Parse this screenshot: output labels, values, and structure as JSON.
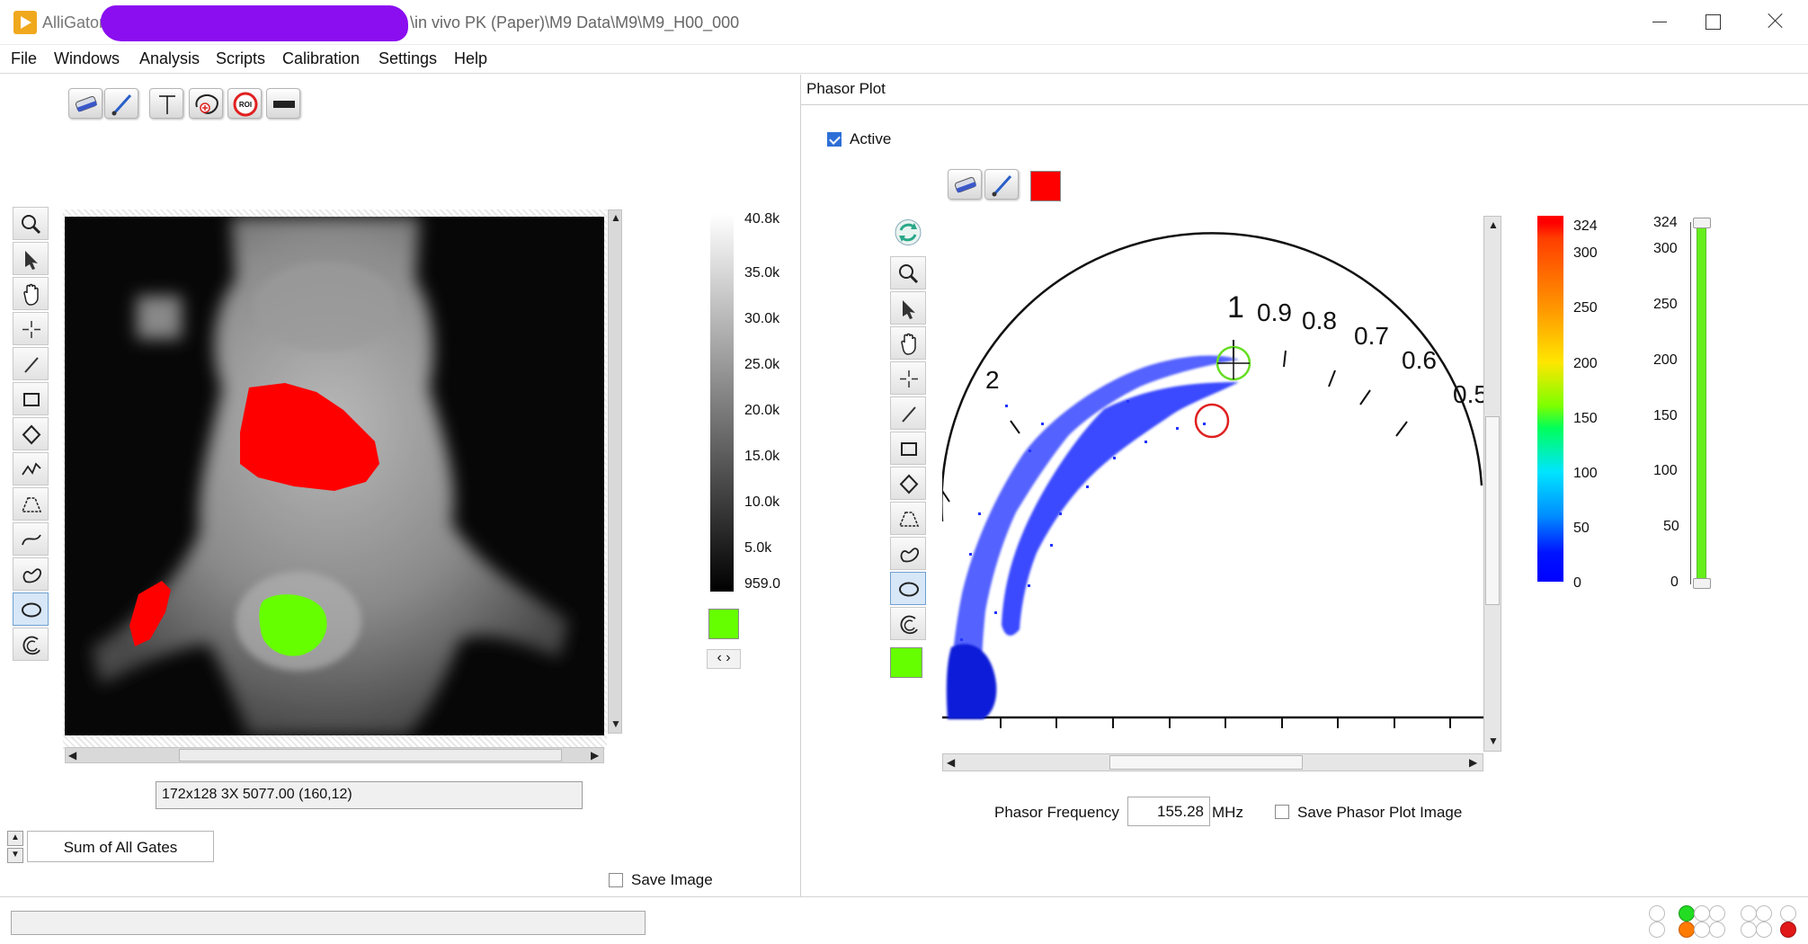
{
  "window": {
    "app_name": "AlliGator",
    "path": "\\in vivo PK (Paper)\\M9 Data\\M9\\M9_H00_000"
  },
  "menu": [
    "File",
    "Windows",
    "Analysis",
    "Scripts",
    "Calibration",
    "Settings",
    "Help"
  ],
  "left": {
    "toolbar_icons": [
      "eraser-icon",
      "brush-icon",
      "text-icon",
      "add-roi-icon",
      "roi-icon",
      "line-icon"
    ],
    "tools": [
      "zoom-icon",
      "pointer-icon",
      "pan-hand-icon",
      "crosshair-icon",
      "line-tool-icon",
      "rectangle-tool-icon",
      "diamond-tool-icon",
      "freehand-tool-icon",
      "polygon-tool-icon",
      "curve-tool-icon",
      "closed-curve-tool-icon",
      "ellipse-tool-icon",
      "circle-arc-tool-icon"
    ],
    "grayscale_ticks": [
      "40.8k",
      "35.0k",
      "30.0k",
      "25.0k",
      "20.0k",
      "15.0k",
      "10.0k",
      "5.0k",
      "959.0"
    ],
    "status_text": "172x128 3X 5077.00    (160,12)",
    "gate_selector": "Sum of All Gates",
    "save_image_label": "Save Image",
    "roi_colors": {
      "red": "#ff0000",
      "green": "#66ff00"
    }
  },
  "right": {
    "panel_title": "Phasor Plot",
    "active_label": "Active",
    "active_checked": true,
    "tools": [
      "refresh-icon",
      "zoom-icon",
      "pointer-icon",
      "pan-hand-icon",
      "crosshair-icon",
      "line-tool-icon",
      "rectangle-tool-icon",
      "diamond-tool-icon",
      "polygon-tool-icon",
      "closed-curve-tool-icon",
      "ellipse-tool-icon",
      "circle-arc-tool-icon"
    ],
    "phasor_labels": [
      "2",
      "1",
      "0.9",
      "0.8",
      "0.7",
      "0.6",
      "0.5"
    ],
    "colorbar_ticks": [
      "324",
      "300",
      "250",
      "200",
      "150",
      "100",
      "50",
      "0"
    ],
    "green_scale_ticks": [
      "324",
      "300",
      "250",
      "200",
      "150",
      "100",
      "50",
      "0"
    ],
    "frequency_label": "Phasor Frequency",
    "frequency_value": "155.28",
    "frequency_unit": "MHz",
    "save_phasor_label": "Save Phasor Plot Image"
  }
}
